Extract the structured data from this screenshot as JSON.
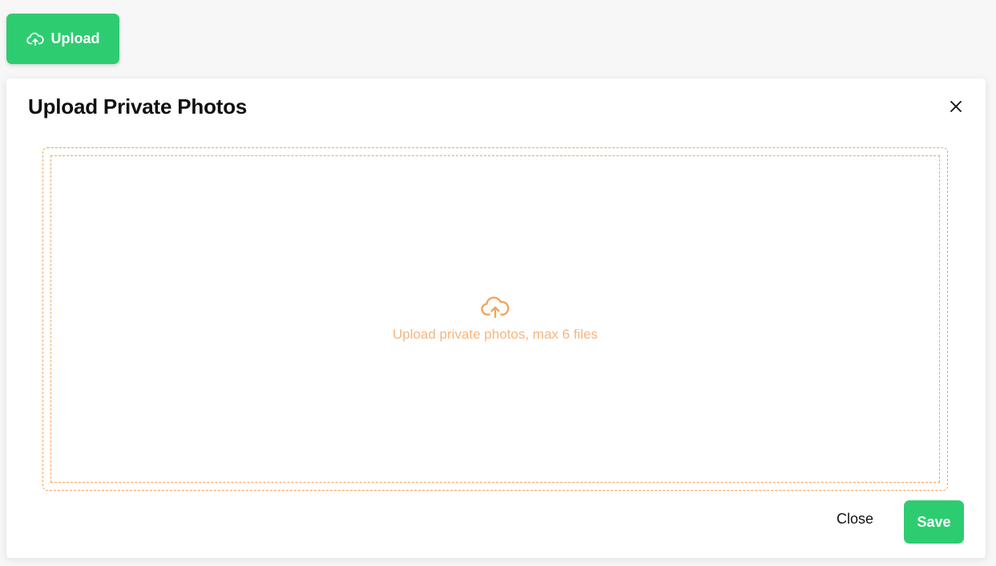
{
  "colors": {
    "accent_green": "#2ecc71",
    "dropzone_border": "#f5a35c",
    "dropzone_text": "#f7b57d",
    "page_background": "#f7f7f7"
  },
  "toolbar": {
    "upload_label": "Upload",
    "upload_icon": "cloud-upload-icon"
  },
  "modal": {
    "title": "Upload Private Photos",
    "close_icon": "close-icon",
    "dropzone": {
      "icon": "cloud-upload-icon",
      "text": "Upload private photos, max 6 files"
    },
    "footer": {
      "close_label": "Close",
      "save_label": "Save"
    }
  }
}
